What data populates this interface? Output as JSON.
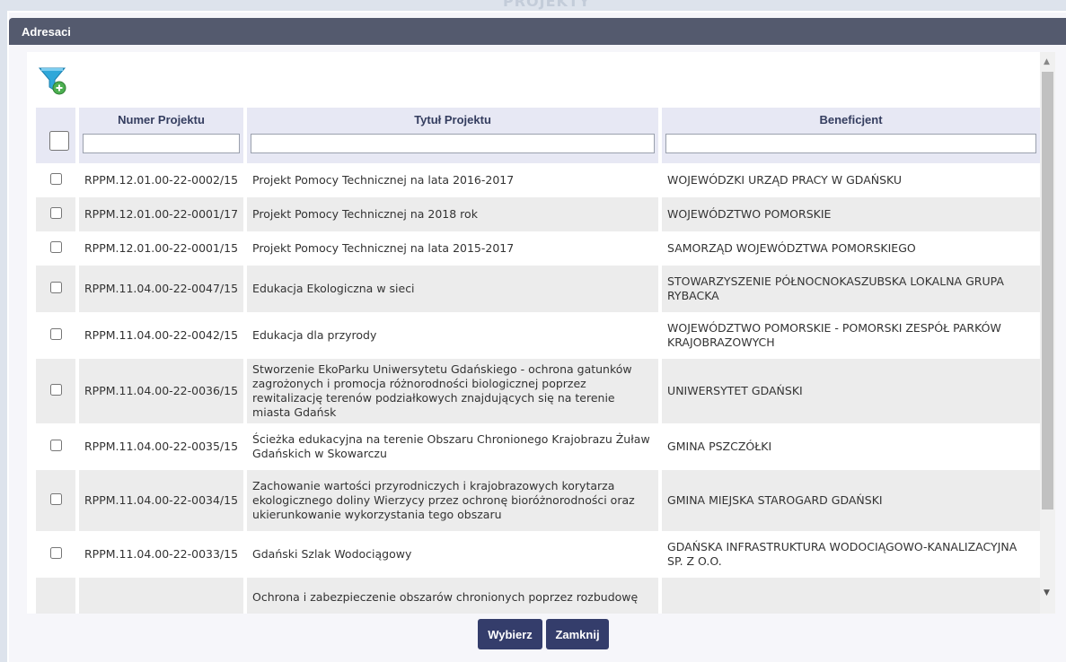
{
  "dialog": {
    "title": "Adresaci",
    "background_label": "PROJEKTY"
  },
  "columns": {
    "number": "Numer Projektu",
    "title": "Tytuł Projektu",
    "beneficiary": "Beneficjent"
  },
  "rows": [
    {
      "number": "RPPM.12.01.00-22-0002/15",
      "title": "Projekt Pomocy Technicznej na lata 2016-2017",
      "beneficiary": "WOJEWÓDZKI URZĄD PRACY W GDAŃSKU"
    },
    {
      "number": "RPPM.12.01.00-22-0001/17",
      "title": "Projekt Pomocy Technicznej na 2018 rok",
      "beneficiary": "WOJEWÓDZTWO POMORSKIE"
    },
    {
      "number": "RPPM.12.01.00-22-0001/15",
      "title": "Projekt Pomocy Technicznej na lata 2015-2017",
      "beneficiary": "SAMORZĄD WOJEWÓDZTWA POMORSKIEGO"
    },
    {
      "number": "RPPM.11.04.00-22-0047/15",
      "title": "Edukacja Ekologiczna w sieci",
      "beneficiary": "STOWARZYSZENIE PÓŁNOCNOKASZUBSKA LOKALNA GRUPA RYBACKA"
    },
    {
      "number": "RPPM.11.04.00-22-0042/15",
      "title": "Edukacja dla przyrody",
      "beneficiary": "WOJEWÓDZTWO POMORSKIE - POMORSKI ZESPÓŁ PARKÓW KRAJOBRAZOWYCH"
    },
    {
      "number": "RPPM.11.04.00-22-0036/15",
      "title": "Stworzenie EkoParku Uniwersytetu Gdańskiego - ochrona gatunków zagrożonych i promocja różnorodności biologicznej poprzez rewitalizację terenów podziałkowych znajdujących się na terenie miasta Gdańsk",
      "beneficiary": "UNIWERSYTET GDAŃSKI"
    },
    {
      "number": "RPPM.11.04.00-22-0035/15",
      "title": "Ścieżka edukacyjna na terenie Obszaru Chronionego Krajobrazu Żuław Gdańskich w Skowarczu",
      "beneficiary": "GMINA PSZCZÓŁKI"
    },
    {
      "number": "RPPM.11.04.00-22-0034/15",
      "title": "Zachowanie wartości przyrodniczych i krajobrazowych korytarza ekologicznego doliny Wierzycy przez ochronę bioróżnorodności oraz ukierunkowanie wykorzystania tego obszaru",
      "beneficiary": "GMINA MIEJSKA STAROGARD GDAŃSKI"
    },
    {
      "number": "RPPM.11.04.00-22-0033/15",
      "title": "Gdański Szlak Wodociągowy",
      "beneficiary": "GDAŃSKA INFRASTRUKTURA WODOCIĄGOWO-KANALIZACYJNA SP. Z O.O."
    },
    {
      "number": "",
      "title": "Ochrona i zabezpieczenie obszarów chronionych poprzez rozbudowę",
      "beneficiary": ""
    }
  ],
  "buttons": {
    "select": "Wybierz",
    "close": "Zamknij"
  },
  "icons": {
    "filter": "filter-add-icon"
  },
  "colors": {
    "titlebar": "#545a6e",
    "header": "#e7e8f4",
    "button": "#343d6b"
  }
}
